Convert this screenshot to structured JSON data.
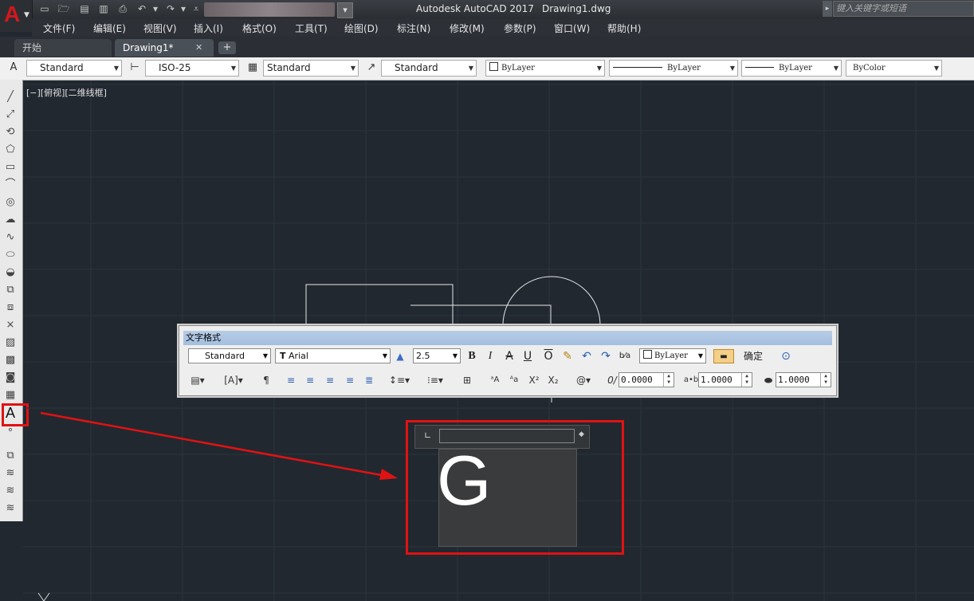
{
  "app": {
    "title": "Autodesk AutoCAD 2017",
    "document": "Drawing1.dwg"
  },
  "search": {
    "placeholder": "键入关键字或短语"
  },
  "menu": [
    "文件(F)",
    "编辑(E)",
    "视图(V)",
    "插入(I)",
    "格式(O)",
    "工具(T)",
    "绘图(D)",
    "标注(N)",
    "修改(M)",
    "参数(P)",
    "窗口(W)",
    "帮助(H)"
  ],
  "tabs": {
    "home": "开始",
    "drawing": "Drawing1*",
    "close": "✕",
    "add": "+"
  },
  "props": {
    "text_style": "Standard",
    "dim_style": "ISO-25",
    "table_style": "Standard",
    "mleader_style": "Standard",
    "color": "ByLayer",
    "linetype": "ByLayer",
    "lineweight": "ByLayer",
    "plot_style": "ByColor"
  },
  "viewport_label": "[−][俯视][二维线框]",
  "text_format": {
    "title": "文字格式",
    "style": "Standard",
    "font": "Arial",
    "height": "2.5",
    "color": "ByLayer",
    "ok": "确定",
    "oblique": "0.0000",
    "tracking": "1.0000",
    "width_factor": "1.0000",
    "bold": "B",
    "italic": "I",
    "strike": "A",
    "underline": "U",
    "overline": "O"
  },
  "editor": {
    "text": "G"
  },
  "colors": {
    "canvas": "#212830",
    "highlight": "#e11212",
    "title_bar": "#a3bedf"
  },
  "icons": [
    "autocad-logo-icon",
    "line-icon",
    "polyline-icon",
    "circle-icon",
    "text-icon",
    "bold-icon",
    "italic-icon"
  ]
}
